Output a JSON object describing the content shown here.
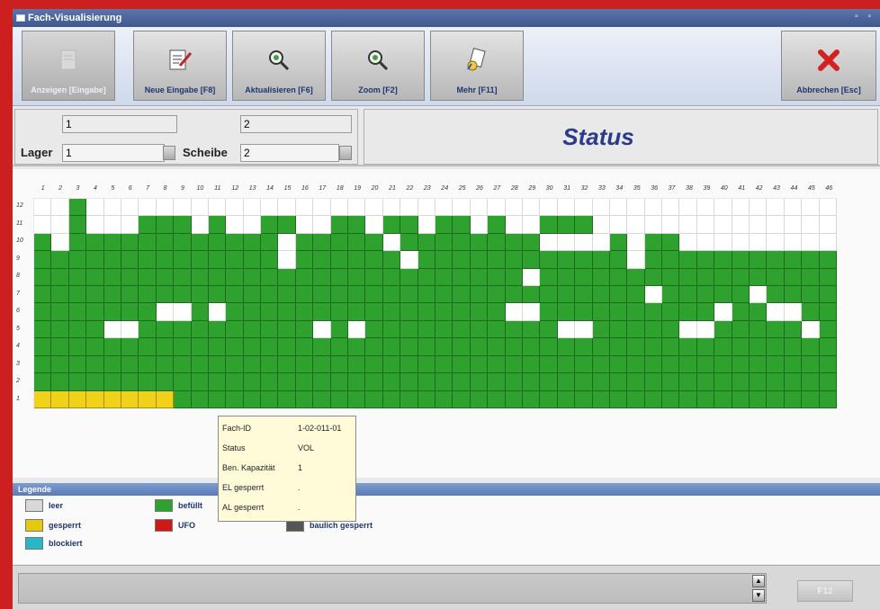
{
  "window": {
    "title": "Fach-Visualisierung"
  },
  "toolbar": {
    "buttons": [
      {
        "label": "Anzeigen [Eingabe]",
        "icon": "document-icon",
        "enabled": false
      },
      {
        "label": "Neue Eingabe [F8]",
        "icon": "edit-icon",
        "enabled": true
      },
      {
        "label": "Aktualisieren [F6]",
        "icon": "magnifier-icon",
        "enabled": true
      },
      {
        "label": "Zoom [F2]",
        "icon": "zoom-icon",
        "enabled": true
      },
      {
        "label": "Mehr [F11]",
        "icon": "more-icon",
        "enabled": true
      },
      {
        "label": "Abbrechen [Esc]",
        "icon": "close-icon",
        "enabled": true
      }
    ]
  },
  "params": {
    "lager_label": "Lager",
    "lager_header": "1",
    "lager_value": "1",
    "scheibe_label": "Scheibe",
    "scheibe_header": "2",
    "scheibe_value": "2"
  },
  "status_title": "Status",
  "grid": {
    "columns": [
      "1",
      "2",
      "3",
      "4",
      "5",
      "6",
      "7",
      "8",
      "9",
      "10",
      "11",
      "12",
      "13",
      "14",
      "15",
      "16",
      "17",
      "18",
      "19",
      "20",
      "21",
      "22",
      "23",
      "24",
      "25",
      "26",
      "27",
      "28",
      "29",
      "30",
      "31",
      "32",
      "33",
      "34",
      "35",
      "36",
      "37",
      "38",
      "39",
      "40",
      "41",
      "42",
      "43",
      "44",
      "45",
      "46"
    ],
    "rows": [
      "12",
      "11",
      "10",
      "9",
      "8",
      "7",
      "6",
      "5",
      "4",
      "3",
      "2",
      "1"
    ],
    "colors": {
      "belegt": "#2fa12f",
      "gesperrt": "#f2d11a",
      "leer": "#ffffff"
    }
  },
  "tooltip": {
    "rows": [
      {
        "key": "Fach-ID",
        "value": "1-02-011-01"
      },
      {
        "key": "Status",
        "value": "VOL"
      },
      {
        "key": "Ben. Kapazität",
        "value": "1"
      },
      {
        "key": "EL gesperrt",
        "value": "."
      },
      {
        "key": "AL gesperrt",
        "value": "."
      }
    ]
  },
  "legend": {
    "title": "Legende",
    "items": [
      {
        "label": "leer",
        "color": "#d8d8d8"
      },
      {
        "label": "befüllt",
        "color": "#2fa12f"
      },
      {
        "label": "gesperrt",
        "color": "#e5c90f"
      },
      {
        "label": "UFO",
        "color": "#d01818"
      },
      {
        "label": "baulich gesperrt",
        "color": "#555555"
      },
      {
        "label": "blockiert",
        "color": "#2ab6c6"
      }
    ]
  },
  "bottom": {
    "f12_label": "F12"
  }
}
